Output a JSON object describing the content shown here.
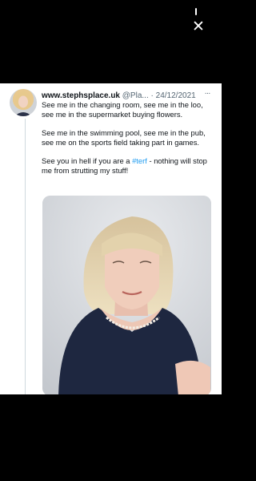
{
  "viewer": {
    "close_label": "✕"
  },
  "tweet": {
    "display_name": "www.stephsplace.uk",
    "handle": "@Pla...",
    "separator": "·",
    "date": "24/12/2021",
    "more_label": "···",
    "paragraphs": [
      "See me in the changing room, see me in the loo, see me in the supermarket buying flowers.",
      "See me in the swimming pool, see me in the pub, see me on the sports field taking part in games."
    ],
    "last_before": "See you in hell if you are a ",
    "hashtag": "#terf",
    "last_after": "  - nothing will stop me from strutting my stuff!"
  }
}
